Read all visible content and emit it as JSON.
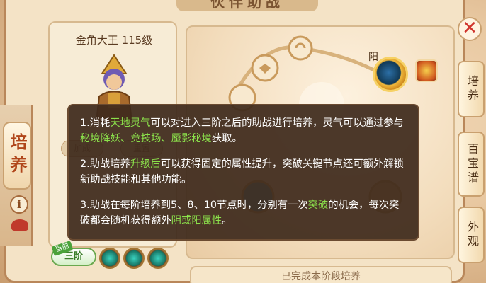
{
  "window": {
    "title": "伙伴助战"
  },
  "left_nav": {
    "tab_label": "培养"
  },
  "character": {
    "name": "金角大王",
    "level": "115级",
    "buttons": [
      "加成",
      "重置"
    ]
  },
  "stage": {
    "current_tag": "当前",
    "badge": "三阶"
  },
  "diagram": {
    "yang_label": "阳"
  },
  "right_tabs": [
    "培养",
    "百宝谱",
    "外观"
  ],
  "bottom_banner": "已完成本阶段培养",
  "tooltip": {
    "p1": {
      "a": "1.消耗",
      "b": "天地灵气",
      "c": "可以对进入三阶之后的助战进行培养，灵气可以通过参与",
      "d": "秘境降妖、竞技场、蜃影秘境",
      "e": "获取。"
    },
    "p2": {
      "a": "2.助战培养",
      "b": "升级后",
      "c": "可以获得固定的属性提升，突破关键节点还可额外解锁新助战技能和其他功能。"
    },
    "p3": {
      "a": "3.助战在每阶培养到5、8、10节点时，分别有一次",
      "b": "突破",
      "c": "的机会，每次突破都会随机获得额外",
      "d": "阴或阳属性",
      "e": "。"
    }
  },
  "colors": {
    "highlight": "#8be04b",
    "tooltip_bg": "#3e2a1c",
    "accent_red": "#d0342c"
  }
}
